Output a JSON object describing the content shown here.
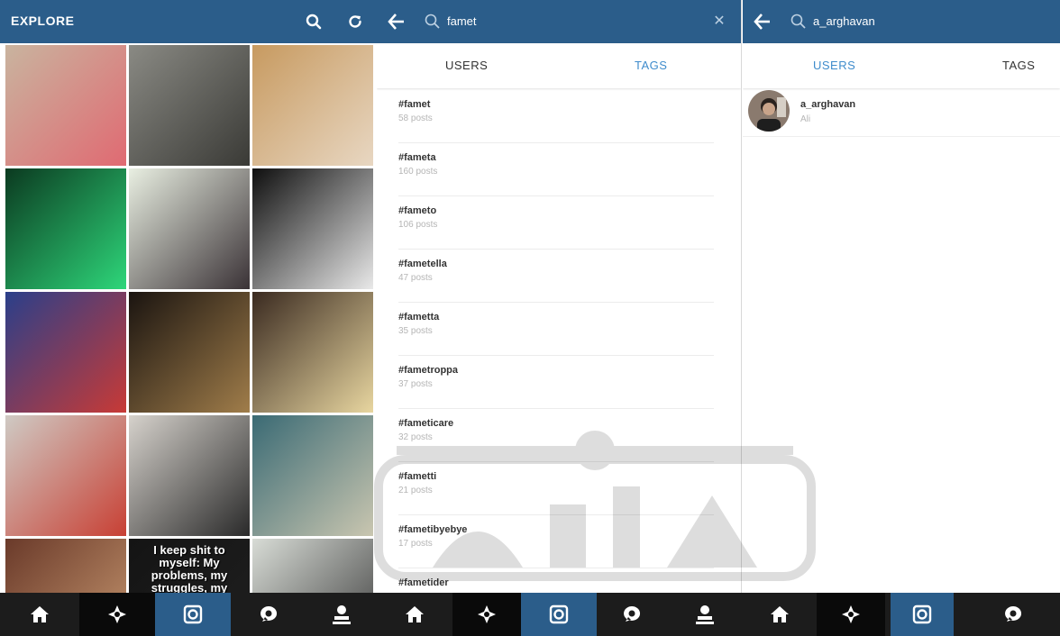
{
  "explore": {
    "title": "EXPLORE",
    "icons": [
      "search-icon",
      "refresh-icon"
    ],
    "tiles": [
      {
        "c1": "#c9b49f",
        "c2": "#e06a72"
      },
      {
        "c1": "#8a8a84",
        "c2": "#3a3a36"
      },
      {
        "c1": "#c79a60",
        "c2": "#e8d7c2"
      },
      {
        "c1": "#0b3a20",
        "c2": "#2ed67a"
      },
      {
        "c1": "#e9efe2",
        "c2": "#3a3236"
      },
      {
        "c1": "#0e0e0e",
        "c2": "#e9e9e9"
      },
      {
        "c1": "#2a3f8a",
        "c2": "#c83a36"
      },
      {
        "c1": "#1a1410",
        "c2": "#a07d4a"
      },
      {
        "c1": "#3a2a20",
        "c2": "#e8d6a0"
      },
      {
        "c1": "#cfcac4",
        "c2": "#c84034"
      },
      {
        "c1": "#d6d2cc",
        "c2": "#2a2a2a"
      },
      {
        "c1": "#3a6a74",
        "c2": "#c9c6b0"
      },
      {
        "c1": "#6a3a2a",
        "c2": "#c89870"
      },
      {
        "c1": "#141414",
        "c2": "#202020",
        "text": "I keep shit to myself: My problems, my struggles, my mistakes."
      },
      {
        "c1": "#d8dcd6",
        "c2": "#3a3a3a"
      }
    ]
  },
  "tags_panel": {
    "search_query": "famet",
    "tabs": {
      "users": "USERS",
      "tags": "TAGS"
    },
    "tags": [
      {
        "name": "#famet",
        "count": "58 posts"
      },
      {
        "name": "#fameta",
        "count": "160 posts"
      },
      {
        "name": "#fameto",
        "count": "106 posts"
      },
      {
        "name": "#fametella",
        "count": "47 posts"
      },
      {
        "name": "#fametta",
        "count": "35 posts"
      },
      {
        "name": "#fametroppa",
        "count": "37 posts"
      },
      {
        "name": "#fameticare",
        "count": "32 posts"
      },
      {
        "name": "#fametti",
        "count": "21 posts"
      },
      {
        "name": "#fametibyebye",
        "count": "17 posts"
      },
      {
        "name": "#fametider",
        "count": ""
      }
    ]
  },
  "users_panel": {
    "search_query": "a_arghavan",
    "tabs": {
      "users": "USERS",
      "tags": "TAGS"
    },
    "user": {
      "username": "a_arghavan",
      "subtitle": "Ali"
    }
  },
  "bottom_nav": {
    "panel1": [
      "home-icon",
      "explore-icon",
      "camera-icon",
      "activity-icon",
      "profile-icon"
    ],
    "panel2": [
      "home-icon",
      "explore-icon",
      "camera-icon",
      "activity-icon",
      "profile-icon"
    ],
    "panel3": [
      "home-icon",
      "explore-icon",
      "camera-icon",
      "activity-icon"
    ]
  },
  "colors": {
    "header": "#2b5d8a",
    "tab_active_blue": "#3f8ccc",
    "nav_bg": "#1c1c1c"
  }
}
